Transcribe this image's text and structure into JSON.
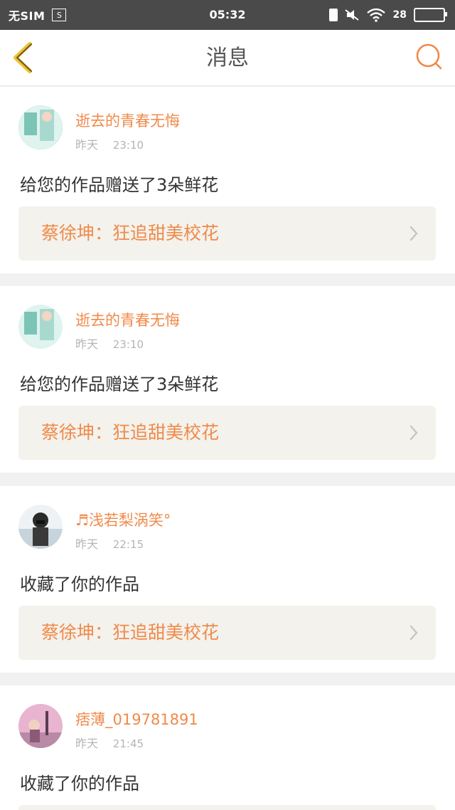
{
  "status_bar": {
    "carrier": "无SIM",
    "time": "05:32",
    "battery_level": "28"
  },
  "header": {
    "title": "消息"
  },
  "messages": [
    {
      "user": "逝去的青春无悔",
      "date": "昨天",
      "time": "23:10",
      "action": "给您的作品赠送了3朵鲜花",
      "work_title": "蔡徐坤：狂追甜美校花"
    },
    {
      "user": "逝去的青春无悔",
      "date": "昨天",
      "time": "23:10",
      "action": "给您的作品赠送了3朵鲜花",
      "work_title": "蔡徐坤：狂追甜美校花"
    },
    {
      "user": "♬浅若梨涡笑°",
      "date": "昨天",
      "time": "22:15",
      "action": "收藏了你的作品",
      "work_title": "蔡徐坤：狂追甜美校花"
    },
    {
      "user": "痞薄_019781891",
      "date": "昨天",
      "time": "21:45",
      "action": "收藏了你的作品",
      "work_title": ""
    }
  ],
  "colors": {
    "accent": "#f08a4b",
    "status_bar": "#4a4a4a",
    "work_button_bg": "#f3f2ec"
  },
  "icons": [
    "back-arrow-icon",
    "search-icon",
    "chevron-right-icon",
    "wifi-icon",
    "battery-icon",
    "charging-icon",
    "mute-icon"
  ]
}
